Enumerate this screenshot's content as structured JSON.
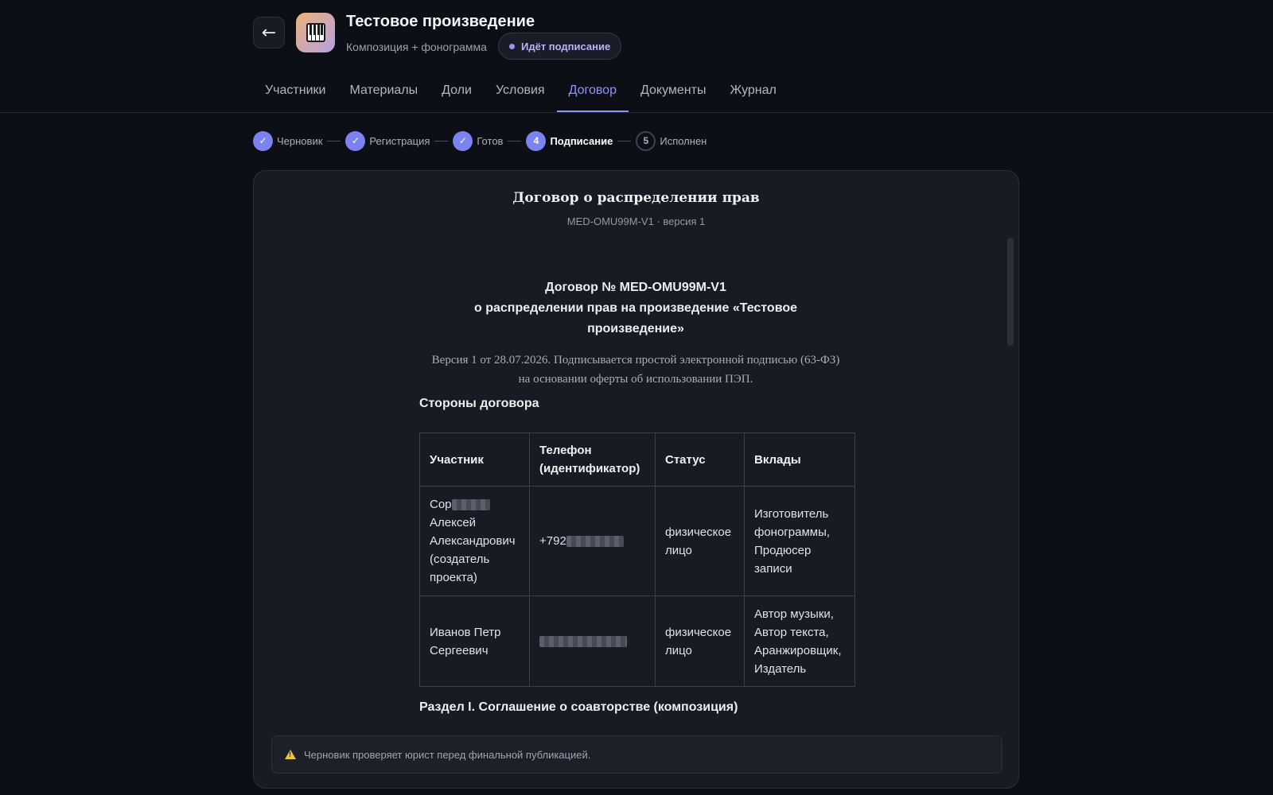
{
  "header": {
    "back_icon": "←",
    "app_icon": "piano-icon",
    "title": "Тестовое произведение",
    "subtitle": "Композиция + фонограмма",
    "status_badge": "Идёт подписание"
  },
  "tabs": [
    {
      "label": "Участники",
      "active": false
    },
    {
      "label": "Материалы",
      "active": false
    },
    {
      "label": "Доли",
      "active": false
    },
    {
      "label": "Условия",
      "active": false
    },
    {
      "label": "Договор",
      "active": true
    },
    {
      "label": "Документы",
      "active": false
    },
    {
      "label": "Журнал",
      "active": false
    }
  ],
  "stepper": [
    {
      "marker": "✓",
      "label": "Черновик",
      "state": "done"
    },
    {
      "marker": "✓",
      "label": "Регистрация",
      "state": "done"
    },
    {
      "marker": "✓",
      "label": "Готов",
      "state": "done"
    },
    {
      "marker": "4",
      "label": "Подписание",
      "state": "current"
    },
    {
      "marker": "5",
      "label": "Исполнен",
      "state": "pending"
    }
  ],
  "document": {
    "title": "Договор о распределении прав",
    "subtitle": "MED-OMU99M-V1 · версия 1",
    "contract_heading": [
      "Договор № MED-OMU99M-V1",
      "о распределении прав на произведение «Тестовое",
      "произведение»"
    ],
    "meta": [
      "Версия 1 от 28.07.2026. Подписывается простой электронной подписью (63-ФЗ)",
      "на основании оферты об использовании ПЭП."
    ],
    "parties_heading": "Стороны договора",
    "parties_table": {
      "columns": [
        "Участник",
        "Телефон (идентификатор)",
        "Статус",
        "Вклады"
      ],
      "rows": [
        {
          "participant": [
            "Сор",
            "Алексей",
            "Александрович",
            "(создатель",
            "проекта)"
          ],
          "phone": "+792",
          "status": [
            "физическое",
            "лицо"
          ],
          "contributions": [
            "Изготовитель",
            "фонограммы,",
            "Продюсер",
            "записи"
          ]
        },
        {
          "participant": [
            "Иванов Петр",
            "Сергеевич"
          ],
          "phone": "",
          "status": [
            "физическое",
            "лицо"
          ],
          "contributions": [
            "Автор музыки,",
            "Автор текста,",
            "Аранжировщик,",
            "Издатель"
          ]
        }
      ]
    },
    "section1_heading": "Раздел I. Соглашение о соавторстве (композиция)"
  },
  "notice": {
    "icon": "warning-icon",
    "text": "Черновик проверяет юрист перед финальной публикацией."
  },
  "colors": {
    "accent": "#8e95f5",
    "step_done": "#7c82f0",
    "warning": "#f0c23a",
    "background": "#0d0f16"
  }
}
